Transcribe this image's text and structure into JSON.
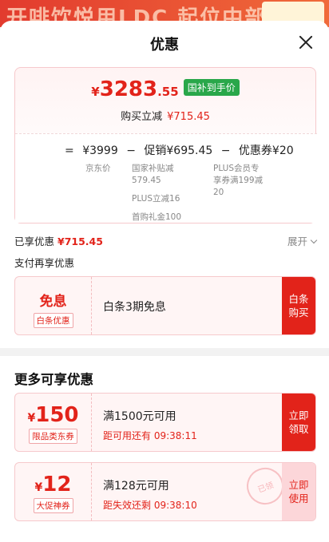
{
  "background_promo": "开啡饮悦用LDC 起位中部联",
  "sheet": {
    "title": "优惠"
  },
  "price_summary": {
    "currency": "¥",
    "final_int": "3283",
    "final_dec": ".55",
    "badge": "国补到手价",
    "reduce_label": "购买立减",
    "reduce_amount": "¥715.45",
    "formula": {
      "eq": "=",
      "base": "¥3999",
      "minus1": "−",
      "promo": "促销¥695.45",
      "minus2": "−",
      "coupon": "优惠券¥20"
    },
    "details": {
      "base_label": "京东价",
      "promo_lines": [
        "国家补贴减",
        "579.45",
        "PLUS立减16",
        "首购礼金100"
      ],
      "coupon_lines": [
        "PLUS会员专",
        "享券满199减",
        "20"
      ]
    }
  },
  "enjoyed": {
    "label": "已享优惠",
    "amount": "¥715.45",
    "expand": "展开"
  },
  "pay_more_label": "支付再享优惠",
  "baitiao": {
    "title": "免息",
    "tag": "白条优惠",
    "desc": "白条3期免息",
    "action": [
      "白条",
      "购买"
    ]
  },
  "more_title": "更多可享优惠",
  "coupons": [
    {
      "currency": "¥",
      "value": "150",
      "tag": "限品类东券",
      "condition": "满1500元可用",
      "countdown": "距可用还有 09:38:11",
      "action": [
        "立即",
        "领取"
      ],
      "style": "red"
    },
    {
      "currency": "¥",
      "value": "12",
      "tag": "大促神券",
      "condition": "满128元可用",
      "countdown": "距失效还剩 09:38:10",
      "action": [
        "立即",
        "使用"
      ],
      "style": "pink",
      "stamp": "已领"
    }
  ],
  "colors": {
    "accent": "#e2231a",
    "badge_green": "#29a74a",
    "card_border": "#f6c9cc"
  },
  "icons": [
    "close-icon",
    "chevron-down-icon"
  ]
}
